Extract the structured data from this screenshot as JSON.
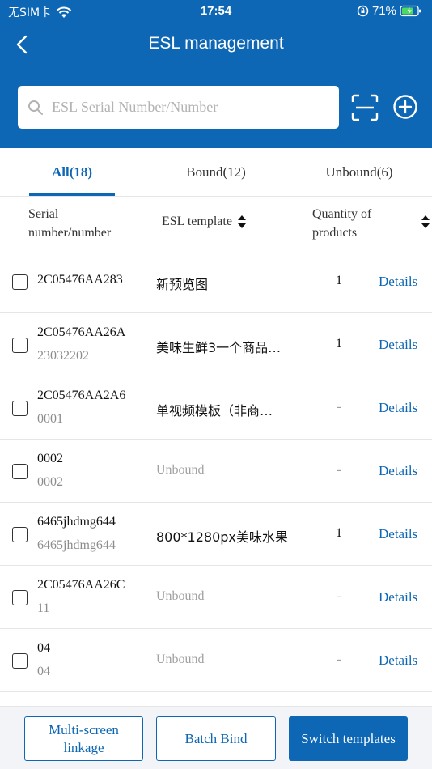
{
  "status_bar": {
    "carrier": "无SIM卡",
    "time": "17:54",
    "battery": "71%"
  },
  "header": {
    "title": "ESL management",
    "search_placeholder": "ESL Serial Number/Number"
  },
  "tabs": [
    {
      "label": "All(18)",
      "active": true
    },
    {
      "label": "Bound(12)",
      "active": false
    },
    {
      "label": "Unbound(6)",
      "active": false
    }
  ],
  "columns": {
    "serial_line1": "Serial",
    "serial_line2": "number/number",
    "template": "ESL template",
    "qty_line1": "Quantity of",
    "qty_line2": "products"
  },
  "rows": [
    {
      "serial": "2C05476AA283",
      "number": "",
      "template": "新预览图",
      "qty": "1",
      "details": "Details"
    },
    {
      "serial": "2C05476AA26A",
      "number": "23032202",
      "template": "美味生鲜3一个商品…",
      "qty": "1",
      "details": "Details"
    },
    {
      "serial": "2C05476AA2A6",
      "number": "0001",
      "template": "单视频模板（非商…",
      "qty": "-",
      "details": "Details"
    },
    {
      "serial": "0002",
      "number": "0002",
      "template": "Unbound",
      "qty": "-",
      "details": "Details"
    },
    {
      "serial": "6465jhdmg644",
      "number": "6465jhdmg644",
      "template": "800*1280px美味水果",
      "qty": "1",
      "details": "Details"
    },
    {
      "serial": "2C05476AA26C",
      "number": "11",
      "template": "Unbound",
      "qty": "-",
      "details": "Details"
    },
    {
      "serial": "04",
      "number": "04",
      "template": "Unbound",
      "qty": "-",
      "details": "Details"
    }
  ],
  "bottom": {
    "multi_line1": "Multi-screen",
    "multi_line2": "linkage",
    "batch_bind": "Batch Bind",
    "switch_templates": "Switch templates"
  },
  "colors": {
    "primary": "#0d67b4",
    "muted": "#a0a0a0"
  }
}
